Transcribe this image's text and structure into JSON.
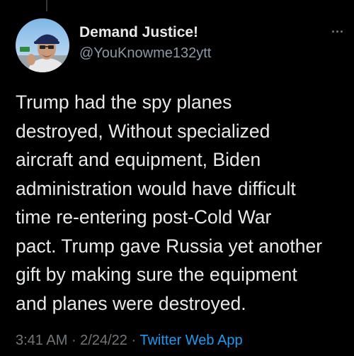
{
  "tweet": {
    "display_name": "Demand Justice!",
    "handle": "@YouKnowme132ytt",
    "text_lines": [
      "Trump had the spy planes",
      "destroyed, Without specialized",
      "aircraft and equipment, Biden",
      "administration would have difficult",
      "time re-entering post-Cold War",
      "pact. Trump gave Russia yet another",
      "gift by making sure the equipment",
      "and planes were destroyed."
    ],
    "time": "3:41 AM",
    "separator": " · ",
    "date": "2/24/22",
    "source": "Twitter Web App",
    "more_icon": "more-horizontal-icon",
    "avatar_icon": "user-avatar"
  },
  "colors": {
    "background": "#000000",
    "primary_text": "#e7e9ea",
    "secondary_text": "#71767b",
    "link": "#1d9bf0"
  }
}
